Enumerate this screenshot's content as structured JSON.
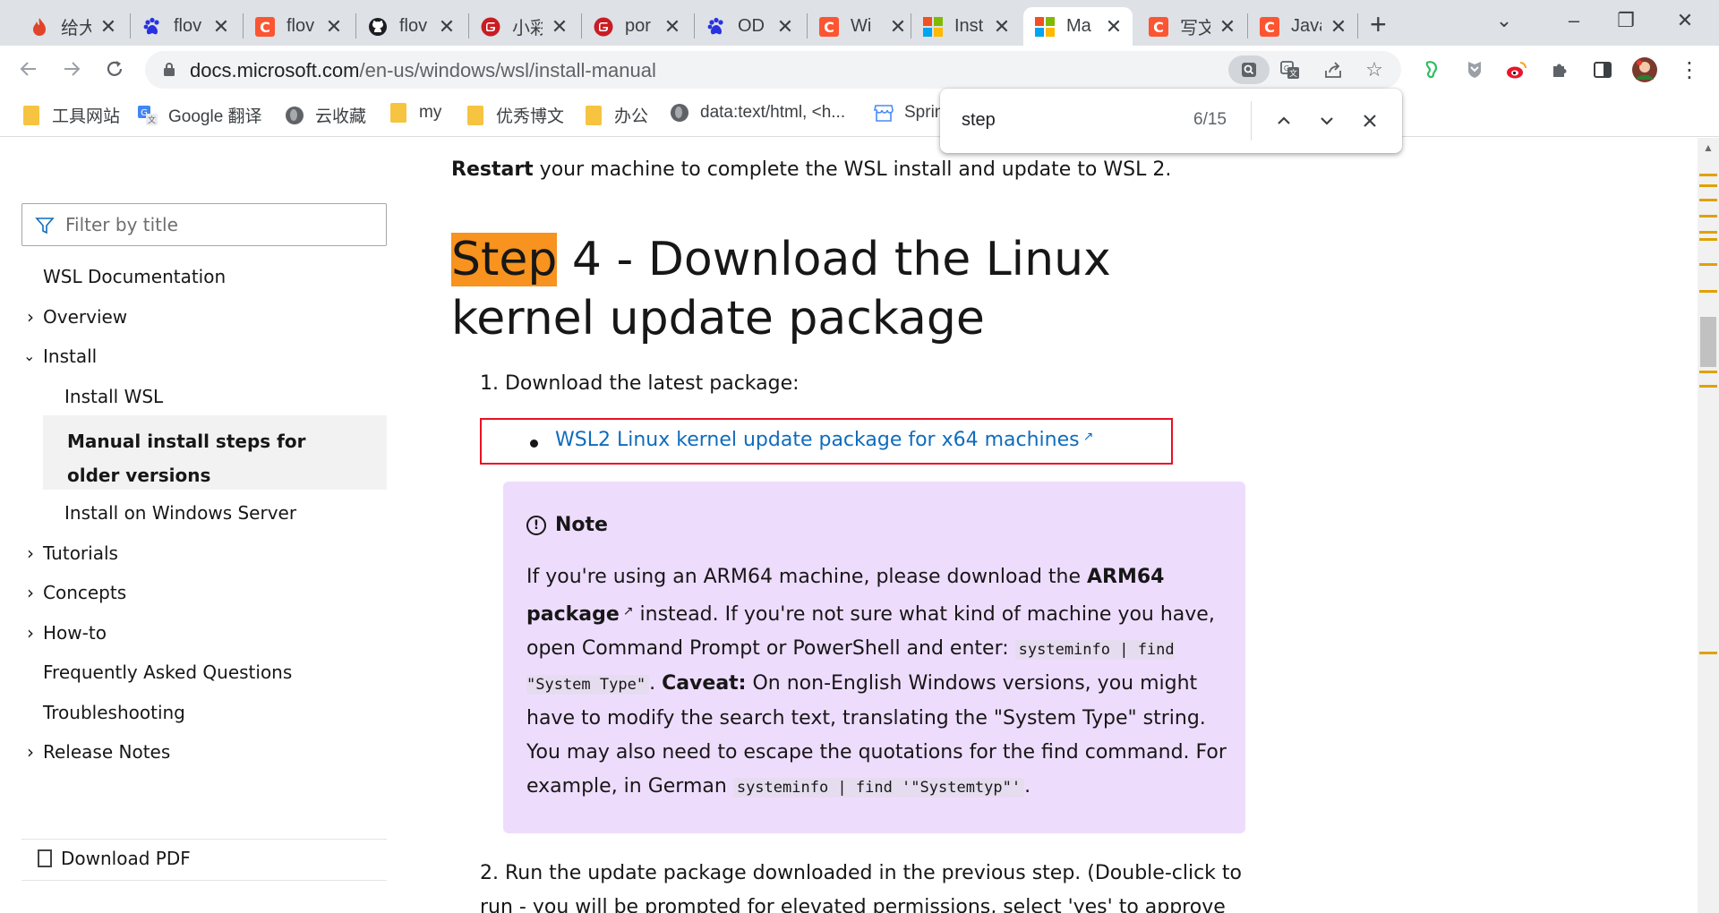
{
  "tabs": [
    {
      "title": "给大",
      "icon": "flame-icon",
      "color": "#e0452c"
    },
    {
      "title": "flov",
      "icon": "baidu-paw-icon",
      "color": "#2932e1"
    },
    {
      "title": "flov",
      "icon": "csdn-icon",
      "color": "#fc5531"
    },
    {
      "title": "flov",
      "icon": "github-icon",
      "color": "#1b1f23"
    },
    {
      "title": "小彩",
      "icon": "gitee-icon",
      "color": "#c71d23"
    },
    {
      "title": "por",
      "icon": "gitee-icon",
      "color": "#c71d23"
    },
    {
      "title": "OD",
      "icon": "baidu-paw-icon",
      "color": "#2932e1"
    },
    {
      "title": "Wi",
      "icon": "csdn-icon",
      "color": "#fc5531"
    },
    {
      "title": "Inst",
      "icon": "microsoft-icon",
      "color": "#f25022"
    },
    {
      "title": "Ma",
      "icon": "microsoft-icon",
      "color": "#f25022",
      "active": true
    },
    {
      "title": "写文",
      "icon": "csdn-icon",
      "color": "#fc5531"
    },
    {
      "title": "Java",
      "icon": "csdn-icon",
      "color": "#fc5531"
    }
  ],
  "address": {
    "host": "docs.microsoft.com",
    "path": "/en-us/windows/wsl/install-manual"
  },
  "bookmarks": [
    {
      "label": "工具网站",
      "icon": "folder-icon"
    },
    {
      "label": "Google 翻译",
      "icon": "google-translate-icon"
    },
    {
      "label": "云收藏",
      "icon": "globe-icon"
    },
    {
      "label": "my",
      "icon": "folder-icon"
    },
    {
      "label": "优秀博文",
      "icon": "folder-icon"
    },
    {
      "label": "办公",
      "icon": "folder-icon"
    },
    {
      "label": "data:text/html, <h...",
      "icon": "globe-icon"
    },
    {
      "label": "Sprin",
      "icon": "store-icon"
    }
  ],
  "find": {
    "query": "step",
    "count": "6/15"
  },
  "sidebar": {
    "filter_placeholder": "Filter by title",
    "items": [
      {
        "label": "WSL Documentation"
      },
      {
        "label": "Overview"
      },
      {
        "label": "Install"
      },
      {
        "label": "Install WSL"
      },
      {
        "label": "Manual install steps for older versions"
      },
      {
        "label": "Install on Windows Server"
      },
      {
        "label": "Tutorials"
      },
      {
        "label": "Concepts"
      },
      {
        "label": "How-to"
      },
      {
        "label": "Frequently Asked Questions"
      },
      {
        "label": "Troubleshooting"
      },
      {
        "label": "Release Notes"
      }
    ],
    "download_pdf": "Download PDF"
  },
  "article": {
    "restart_bold": "Restart",
    "restart_rest": " your machine to complete the WSL install and update to WSL 2.",
    "heading_highlight": "Step",
    "heading_rest": " 4 - Download the Linux kernel update package",
    "step1": "1. Download the latest package:",
    "link": "WSL2 Linux kernel update package for x64 machines",
    "note": {
      "title": "Note",
      "t1": "If you're using an ARM64 machine, please download the ",
      "arm_link": "ARM64 package",
      "t2": " instead. If you're not sure what kind of machine you have, open Command Prompt or PowerShell and enter: ",
      "code1": "systeminfo | find \"System Type\"",
      "t3": ". ",
      "caveat": "Caveat:",
      "t4": " On non-English Windows versions, you might have to modify the search text, translating the \"System Type\" string. You may also need to escape the quotations for the find command. For example, in German ",
      "code2": "systeminfo | find '\"Systemtyp\"'",
      "t5": "."
    },
    "step2": "2. Run the update package downloaded in the previous step. (Double-click to run - you will be prompted for elevated permissions, select 'yes' to approve"
  },
  "colors": {
    "highlight": "#f7931e",
    "link": "#0f6cbd",
    "note_bg": "#eedcfd",
    "red_box": "#e81123"
  }
}
